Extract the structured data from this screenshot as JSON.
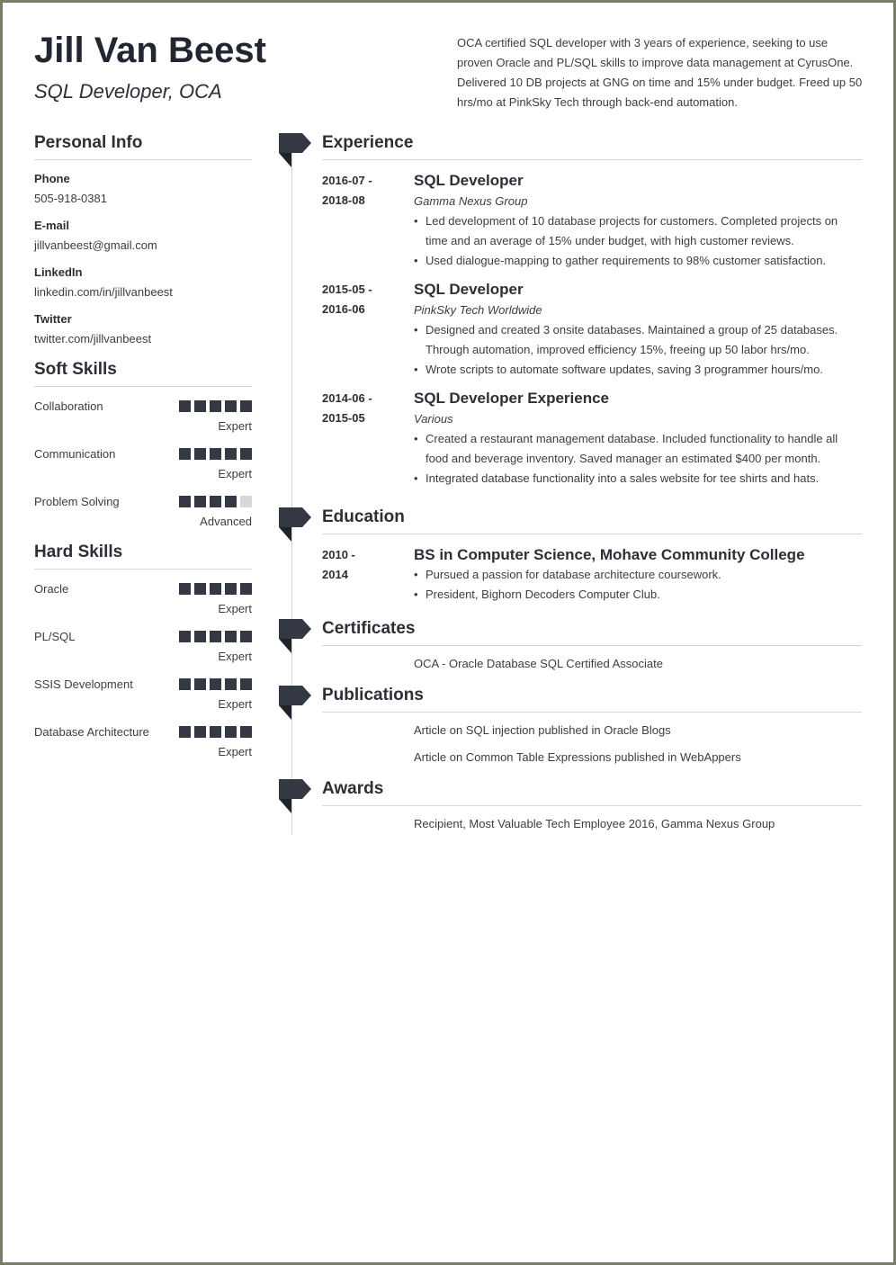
{
  "header": {
    "name": "Jill Van Beest",
    "title": "SQL Developer, OCA",
    "summary": "OCA certified SQL developer with 3 years of experience, seeking to use proven Oracle and PL/SQL skills to improve data management at CyrusOne. Delivered 10 DB projects at GNG on time and 15% under budget. Freed up 50 hrs/mo at PinkSky Tech through back-end automation."
  },
  "personal_info": {
    "title": "Personal Info",
    "items": [
      {
        "label": "Phone",
        "value": "505-918-0381"
      },
      {
        "label": "E-mail",
        "value": "jillvanbeest@gmail.com"
      },
      {
        "label": "LinkedIn",
        "value": "linkedin.com/in/jillvanbeest"
      },
      {
        "label": "Twitter",
        "value": "twitter.com/jillvanbeest"
      }
    ]
  },
  "soft_skills": {
    "title": "Soft Skills",
    "items": [
      {
        "name": "Collaboration",
        "level": "Expert",
        "rating": 5,
        "max": 5
      },
      {
        "name": "Communication",
        "level": "Expert",
        "rating": 5,
        "max": 5
      },
      {
        "name": "Problem Solving",
        "level": "Advanced",
        "rating": 4,
        "max": 5
      }
    ]
  },
  "hard_skills": {
    "title": "Hard Skills",
    "items": [
      {
        "name": "Oracle",
        "level": "Expert",
        "rating": 5,
        "max": 5
      },
      {
        "name": "PL/SQL",
        "level": "Expert",
        "rating": 5,
        "max": 5
      },
      {
        "name": "SSIS Development",
        "level": "Expert",
        "rating": 5,
        "max": 5
      },
      {
        "name": "Database Architecture",
        "level": "Expert",
        "rating": 5,
        "max": 5
      }
    ]
  },
  "experience": {
    "title": "Experience",
    "items": [
      {
        "date_start": "2016-07 -",
        "date_end": "2018-08",
        "title": "SQL Developer",
        "company": "Gamma Nexus Group",
        "bullets": [
          "Led development of 10 database projects for customers. Completed projects on time and an average of 15% under budget, with high customer reviews.",
          "Used dialogue-mapping to gather requirements to 98% customer satisfaction."
        ]
      },
      {
        "date_start": "2015-05 -",
        "date_end": "2016-06",
        "title": "SQL Developer",
        "company": "PinkSky Tech Worldwide",
        "bullets": [
          "Designed and created 3 onsite databases. Maintained a group of 25 databases. Through automation, improved efficiency 15%, freeing up 50 labor hrs/mo.",
          "Wrote scripts to automate software updates, saving 3 programmer hours/mo."
        ]
      },
      {
        "date_start": "2014-06 -",
        "date_end": "2015-05",
        "title": "SQL Developer Experience",
        "company": "Various",
        "bullets": [
          "Created a restaurant management database. Included functionality to handle all food and beverage inventory. Saved manager an estimated $400 per month.",
          "Integrated database functionality into a sales website for tee shirts and hats."
        ]
      }
    ]
  },
  "education": {
    "title": "Education",
    "items": [
      {
        "date_start": "2010 -",
        "date_end": "2014",
        "title": "BS in Computer Science, Mohave Community College",
        "bullets": [
          "Pursued a passion for database architecture coursework.",
          "President, Bighorn Decoders Computer Club."
        ]
      }
    ]
  },
  "certificates": {
    "title": "Certificates",
    "items": [
      "OCA - Oracle Database SQL Certified Associate"
    ]
  },
  "publications": {
    "title": "Publications",
    "items": [
      "Article on SQL injection published in Oracle Blogs",
      "Article on Common Table Expressions published in WebAppers"
    ]
  },
  "awards": {
    "title": "Awards",
    "items": [
      "Recipient, Most Valuable Tech Employee 2016, Gamma Nexus Group"
    ]
  },
  "colors": {
    "accent": "#333842",
    "bar_empty": "#d8d8d8",
    "frame": "#7a7c68"
  }
}
